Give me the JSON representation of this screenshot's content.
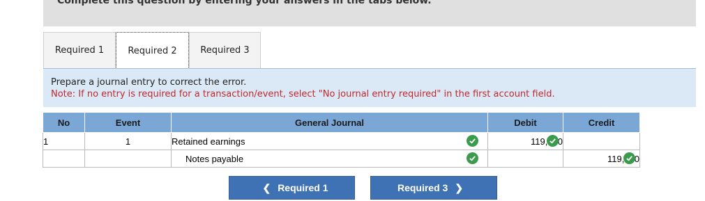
{
  "banner": {
    "text": "Complete this question by entering your answers in the tabs below."
  },
  "tabs": [
    {
      "label": "Required 1"
    },
    {
      "label": "Required 2"
    },
    {
      "label": "Required 3"
    }
  ],
  "instructions": {
    "line1": "Prepare a journal entry to correct the error.",
    "line2": "Note: If no entry is required for a transaction/event, select \"No journal entry required\" in the first account field."
  },
  "journal": {
    "headers": {
      "no": "No",
      "event": "Event",
      "general_journal": "General Journal",
      "debit": "Debit",
      "credit": "Credit"
    },
    "rows": [
      {
        "no": "1",
        "event": "1",
        "account": "Retained earnings",
        "debit": "119,000",
        "credit": ""
      },
      {
        "no": "",
        "event": "",
        "account": "Notes payable",
        "debit": "",
        "credit": "119,000"
      }
    ]
  },
  "nav": {
    "prev_label": "Required 1",
    "next_label": "Required 3"
  },
  "colors": {
    "header_blue": "#7ba7d7",
    "button_blue": "#3f72b5",
    "check_green": "#3a9b4c",
    "note_red": "#c0282d"
  }
}
